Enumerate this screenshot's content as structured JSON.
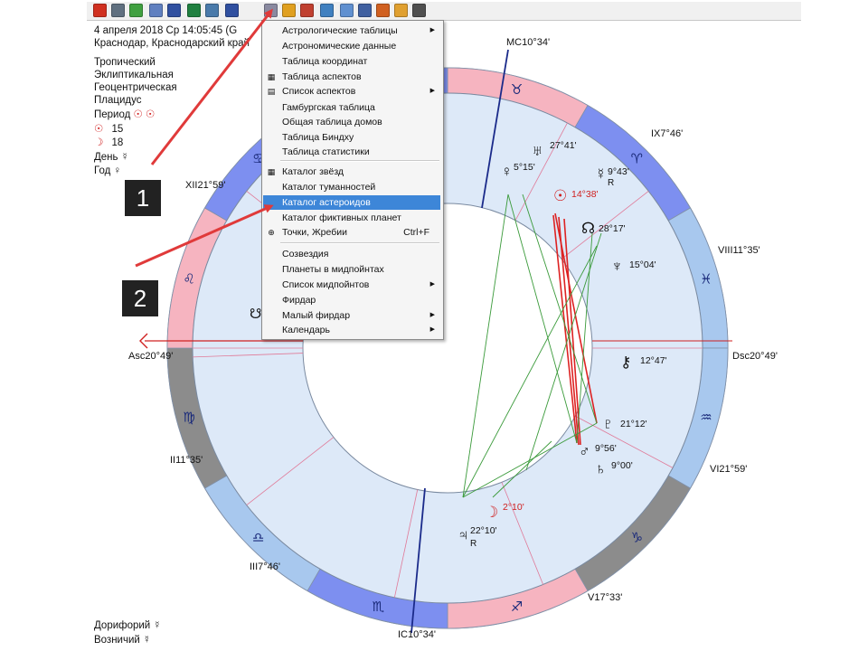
{
  "toolbar": {
    "icons": [
      "record-icon",
      "chart-table-icon",
      "globe-icon",
      "moon-phase-icon",
      "star-map-icon",
      "flag-icon",
      "book-icon",
      "heart-icon",
      "tables-icon",
      "grid-icon",
      "document-icon",
      "image-icon",
      "page-icon",
      "target-icon",
      "tools-icon",
      "person-icon",
      "statistics-icon"
    ],
    "colors": [
      "#d03020",
      "#607080",
      "#40a040",
      "#6080c0",
      "#3050a0",
      "#208040",
      "#4a7aaa",
      "#3050a0",
      "#8a8aa0",
      "#e0a020",
      "#c04030",
      "#4080c0",
      "#6090d0",
      "#4060a0",
      "#d06020",
      "#e0a030",
      "#505050"
    ]
  },
  "info": {
    "date_line": "4 апреля 2018  Ср  14:05:45 (G",
    "place_line": "Краснодар, Краснодарский край",
    "zodiac": "Тропический",
    "coords": "Эклиптикальная",
    "center": "Геоцентрическая",
    "houses": "Плацидус",
    "period_label": "Период",
    "period_glyphs": "☉ ☉",
    "sun_glyph": "☉",
    "sun_value": "15",
    "moon_glyph": "☽",
    "moon_value": "18",
    "day_label": "День",
    "day_glyph": "☿",
    "year_label": "Год",
    "year_glyph": "♀",
    "doryphory_label": "Дорифорий",
    "doryphory_glyph": "☿",
    "vozniy_label": "Возничий",
    "vozniy_glyph": "☿"
  },
  "menu": {
    "items": [
      {
        "label": "Астрологические таблицы",
        "arrow": "▶",
        "icon": ""
      },
      {
        "label": "Астрономические данные",
        "arrow": "",
        "icon": ""
      },
      {
        "label": "Таблица координат",
        "arrow": "",
        "icon": ""
      },
      {
        "label": "Таблица аспектов",
        "arrow": "",
        "icon": "▦"
      },
      {
        "label": "Список аспектов",
        "arrow": "▶",
        "icon": "▤"
      },
      {
        "label": "Гамбургская таблица",
        "arrow": "",
        "icon": ""
      },
      {
        "label": "Общая таблица домов",
        "arrow": "",
        "icon": ""
      },
      {
        "label": "Таблица Биндху",
        "arrow": "",
        "icon": ""
      },
      {
        "label": "Таблица статистики",
        "arrow": "",
        "icon": ""
      },
      {
        "label": "Каталог звёзд",
        "arrow": "",
        "icon": "▦"
      },
      {
        "label": "Каталог туманностей",
        "arrow": "",
        "icon": ""
      },
      {
        "label": "Каталог астероидов",
        "arrow": "",
        "icon": ""
      },
      {
        "label": "Каталог фиктивных планет",
        "arrow": "",
        "icon": ""
      },
      {
        "label": "Точки, Жребии",
        "arrow": "",
        "icon": "⊕",
        "shortcut": "Ctrl+F"
      },
      {
        "label": "Созвездия",
        "arrow": "",
        "icon": ""
      },
      {
        "label": "Планеты в мидпойнтах",
        "arrow": "",
        "icon": ""
      },
      {
        "label": "Список мидпойнтов",
        "arrow": "▶",
        "icon": ""
      },
      {
        "label": "Фирдар",
        "arrow": "",
        "icon": ""
      },
      {
        "label": "Малый фирдар",
        "arrow": "▶",
        "icon": ""
      },
      {
        "label": "Календарь",
        "arrow": "▶",
        "icon": ""
      }
    ],
    "highlighted": "Каталог астероидов"
  },
  "callouts": {
    "one": "1",
    "two": "2"
  },
  "chart": {
    "signs": [
      "♈",
      "♉",
      "♊",
      "♋",
      "♌",
      "♍",
      "♎",
      "♏",
      "♐",
      "♑",
      "♒",
      "♓"
    ],
    "house_labels": {
      "mc": "MC10°34'",
      "ix": "IX7°46'",
      "xii": "XII21°59'",
      "viii": "VIII11°35'",
      "asc": "Asc20°49'",
      "dsc": "Dsc20°49'",
      "ii": "II11°35'",
      "vi": "VI21°59'",
      "iii": "III7°46'",
      "v": "V17°33'",
      "ic": "IC10°34'"
    },
    "planets": {
      "uranus_deg": "27°41'",
      "venus_deg": "5°15'",
      "mercury_deg": "9°43'",
      "mercury_r": "R",
      "sun_deg": "14°38'",
      "node_deg": "28°17'",
      "neptune_deg": "15°04'",
      "chiron_deg": "12°47'",
      "pluto_deg": "21°12'",
      "mars_deg": "9°56'",
      "saturn_deg": "9°00'",
      "moon_deg": "2°10'",
      "jupiter_deg": "22°10'",
      "jupiter_r": "R"
    },
    "colors": {
      "ring": "#dde9f8",
      "pink": "#f6b4c0",
      "blue": "#7d8ff0",
      "grey": "#8c8c8c",
      "sky": "#a8c8ee",
      "sun": "#d02020",
      "red_aspect": "#dd2222",
      "green_aspect": "#3a9a3a"
    }
  }
}
